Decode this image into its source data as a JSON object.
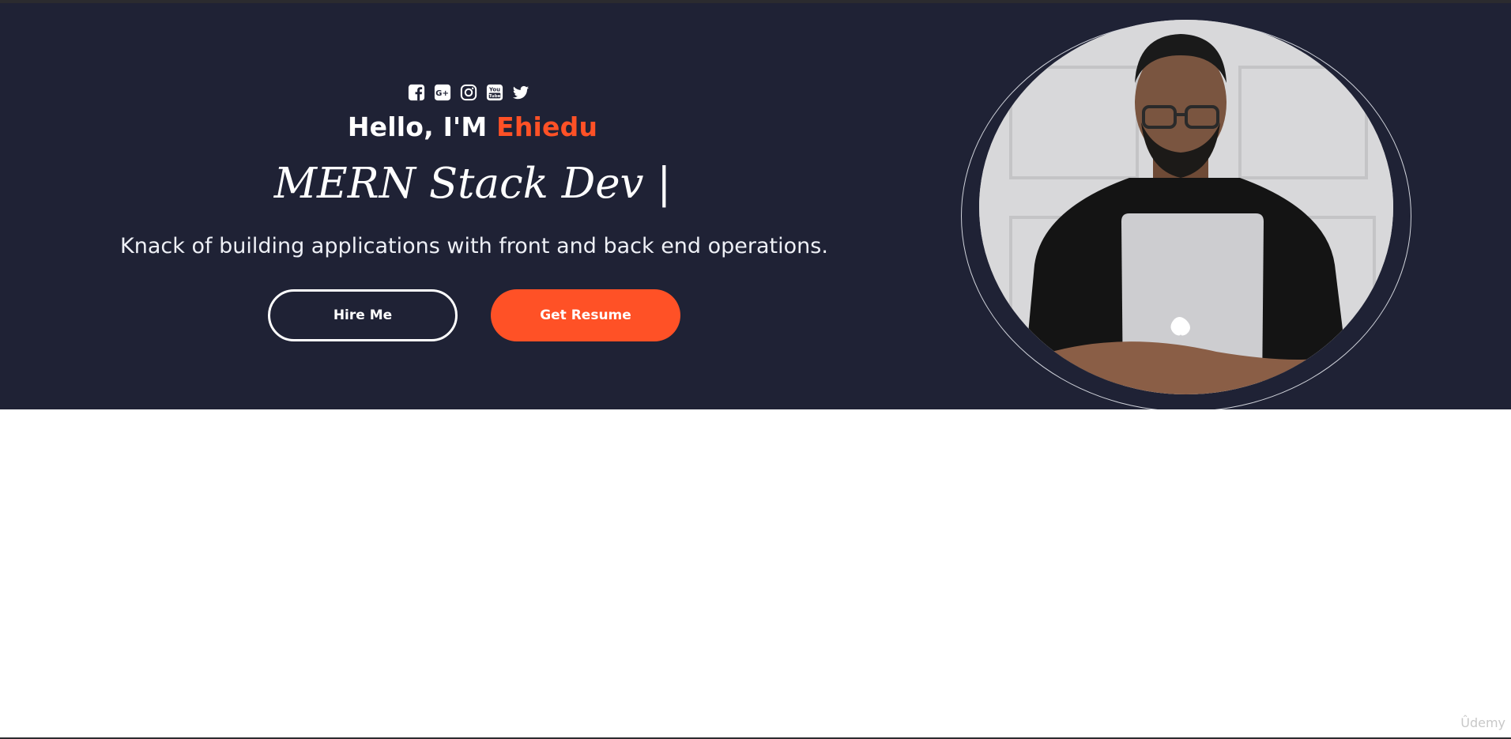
{
  "hero": {
    "social_icons": [
      "facebook-icon",
      "google-plus-icon",
      "instagram-icon",
      "youtube-icon",
      "twitter-icon"
    ],
    "greeting": "Hello, I'M ",
    "name": "Ehiedu",
    "role": "MERN Stack Dev",
    "cursor": "|",
    "tagline": "Knack of building applications with front and back end operations.",
    "hire_label": "Hire Me",
    "resume_label": "Get Resume"
  },
  "watermark": "Ûdemy",
  "colors": {
    "background": "#1f2235",
    "accent": "#ff5126",
    "text": "#ffffff"
  }
}
